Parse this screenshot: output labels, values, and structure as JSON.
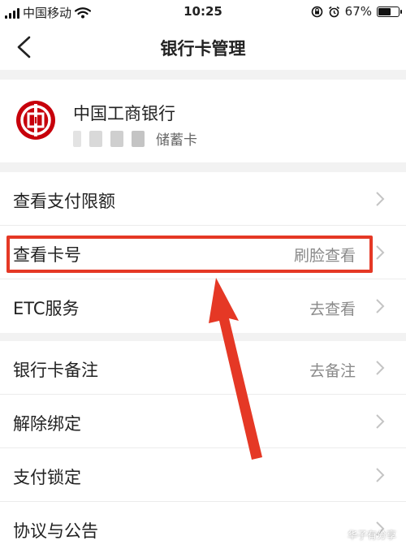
{
  "status_bar": {
    "carrier": "中国移动",
    "time": "10:25",
    "battery_percent": "67%",
    "battery_level": 0.67
  },
  "nav": {
    "title": "银行卡管理",
    "back_icon": "chevron-left-icon"
  },
  "card": {
    "bank_name": "中国工商银行",
    "card_type": "储蓄卡",
    "logo_color": "#c7000b"
  },
  "menu_group_1": [
    {
      "label": "查看支付限额",
      "value": ""
    },
    {
      "label": "查看卡号",
      "value": "刷脸查看"
    },
    {
      "label": "ETC服务",
      "value": "去查看"
    }
  ],
  "menu_group_2": [
    {
      "label": "银行卡备注",
      "value": "去备注"
    },
    {
      "label": "解除绑定",
      "value": ""
    },
    {
      "label": "支付锁定",
      "value": ""
    },
    {
      "label": "协议与公告",
      "value": ""
    }
  ],
  "annotation": {
    "color": "#e53825"
  },
  "watermark": {
    "text": "华子有分享"
  }
}
